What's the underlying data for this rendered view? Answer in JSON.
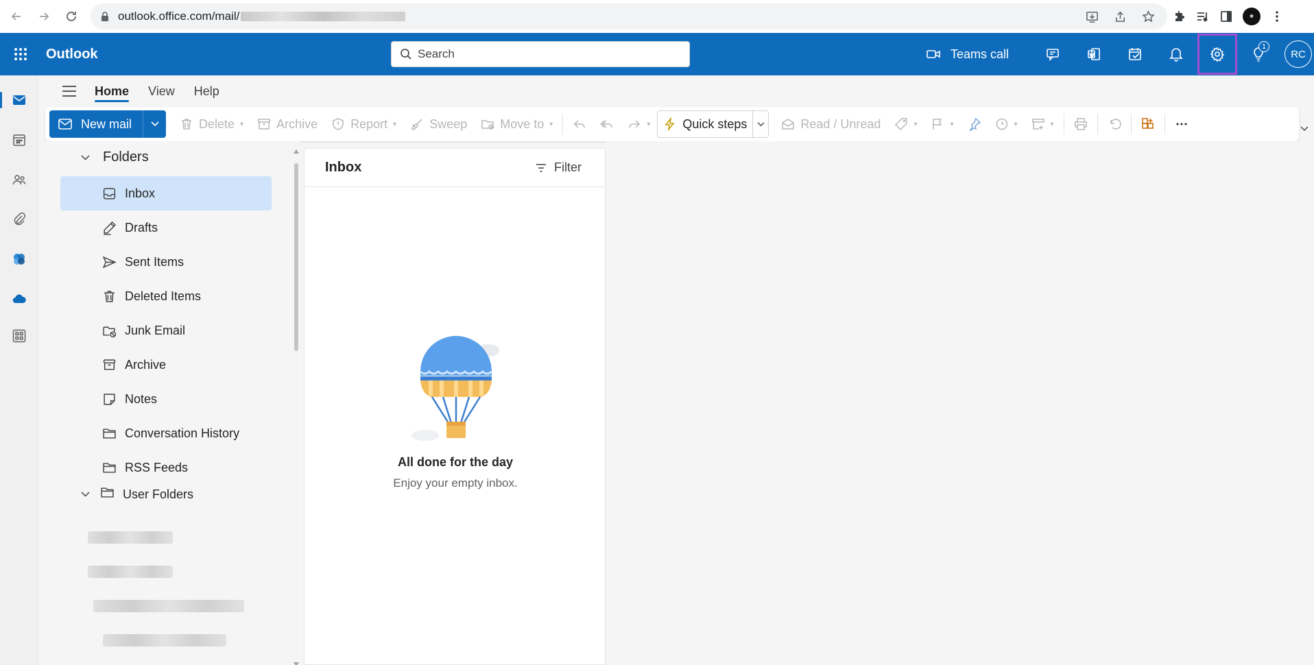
{
  "browser": {
    "url": "outlook.office.com/mail/"
  },
  "header": {
    "app_name": "Outlook",
    "search_placeholder": "Search",
    "teams_call_label": "Teams call",
    "notification_badge": "1",
    "avatar_initials": "RC",
    "brand_color": "#0f6cbd",
    "highlight_color": "#a04dcf"
  },
  "tabs": [
    {
      "label": "Home",
      "active": true
    },
    {
      "label": "View",
      "active": false
    },
    {
      "label": "Help",
      "active": false
    }
  ],
  "ribbon": {
    "new_mail": "New mail",
    "delete": "Delete",
    "archive": "Archive",
    "report": "Report",
    "sweep": "Sweep",
    "move_to": "Move to",
    "quick_steps": "Quick steps",
    "read_unread": "Read / Unread"
  },
  "folders": {
    "header": "Folders",
    "items": [
      {
        "label": "Inbox",
        "icon": "inbox-icon",
        "selected": true
      },
      {
        "label": "Drafts",
        "icon": "pencil-icon"
      },
      {
        "label": "Sent Items",
        "icon": "send-icon"
      },
      {
        "label": "Deleted Items",
        "icon": "trash-icon"
      },
      {
        "label": "Junk Email",
        "icon": "junk-icon"
      },
      {
        "label": "Archive",
        "icon": "archive-icon"
      },
      {
        "label": "Notes",
        "icon": "note-icon"
      },
      {
        "label": "Conversation History",
        "icon": "folder-icon"
      },
      {
        "label": "RSS Feeds",
        "icon": "folder-icon"
      }
    ],
    "user_folders": "User Folders"
  },
  "message_list": {
    "title": "Inbox",
    "filter_label": "Filter",
    "empty_title": "All done for the day",
    "empty_subtitle": "Enjoy your empty inbox."
  }
}
